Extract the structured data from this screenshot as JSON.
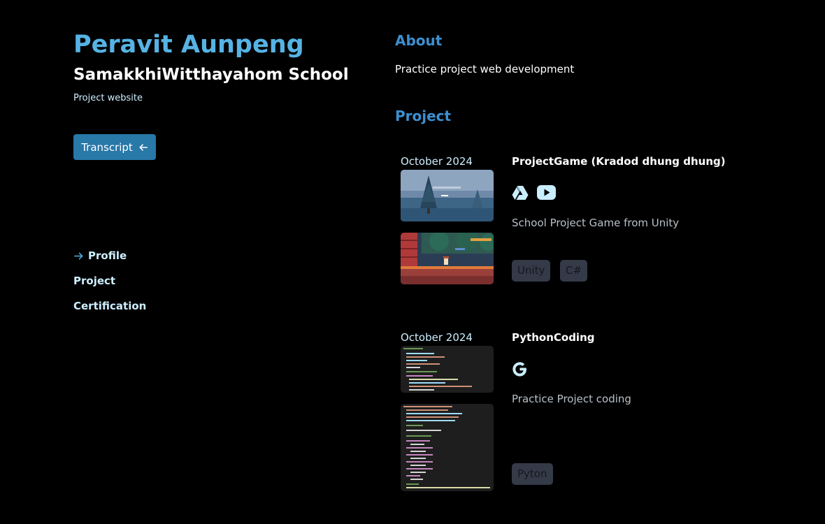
{
  "profile": {
    "name": "Peravit Aunpeng",
    "school": "SamakkhiWitthayahom School",
    "tagline": "Project website",
    "transcript_label": "Transcript"
  },
  "nav": {
    "items": [
      {
        "label": "Profile",
        "active": true
      },
      {
        "label": "Project",
        "active": false
      },
      {
        "label": "Certification",
        "active": false
      }
    ]
  },
  "about": {
    "heading": "About",
    "text": "Practice project web development"
  },
  "projects_section": {
    "heading": "Project"
  },
  "projects": [
    {
      "date": "October 2024",
      "title": "ProjectGame (Kradod dhung dhung)",
      "links": [
        "google-drive-icon",
        "youtube-icon"
      ],
      "description": "School Project Game from Unity",
      "tags": [
        "Unity",
        "C#"
      ]
    },
    {
      "date": "October 2024",
      "title": "PythonCoding",
      "links": [
        "google-icon"
      ],
      "description": "Practice Project coding",
      "tags": [
        "Pyton"
      ]
    }
  ],
  "colors": {
    "background": "#000000",
    "accent": "#56b3e4",
    "section_heading": "#3d8fd0",
    "button": "#2878a8",
    "light_text": "#cdeeff",
    "tag_bg": "#343a47"
  }
}
